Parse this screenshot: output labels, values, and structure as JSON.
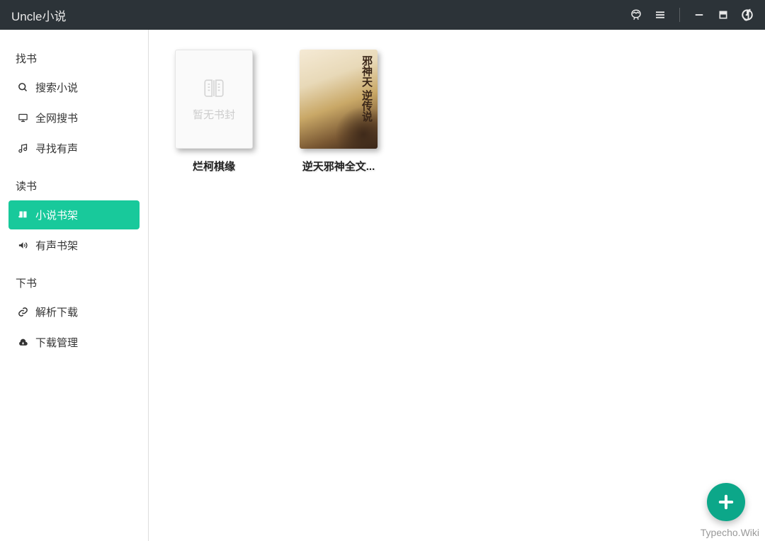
{
  "titlebar": {
    "title": "Uncle小说"
  },
  "sidebar": {
    "sections": [
      {
        "header": "找书",
        "items": [
          {
            "icon": "search",
            "label": "搜索小说"
          },
          {
            "icon": "monitor",
            "label": "全网搜书"
          },
          {
            "icon": "music",
            "label": "寻找有声"
          }
        ]
      },
      {
        "header": "读书",
        "items": [
          {
            "icon": "book",
            "label": "小说书架",
            "active": true
          },
          {
            "icon": "audio",
            "label": "有声书架"
          }
        ]
      },
      {
        "header": "下书",
        "items": [
          {
            "icon": "link",
            "label": "解析下载"
          },
          {
            "icon": "cloud",
            "label": "下载管理"
          }
        ]
      }
    ]
  },
  "books": [
    {
      "title": "烂柯棋缘",
      "cover_type": "placeholder",
      "placeholder_text": "暂无书封"
    },
    {
      "title": "逆天邪神全文...",
      "cover_type": "art",
      "cover_title": "邪神天\n逆传说"
    }
  ],
  "watermark": "Typecho.Wiki"
}
